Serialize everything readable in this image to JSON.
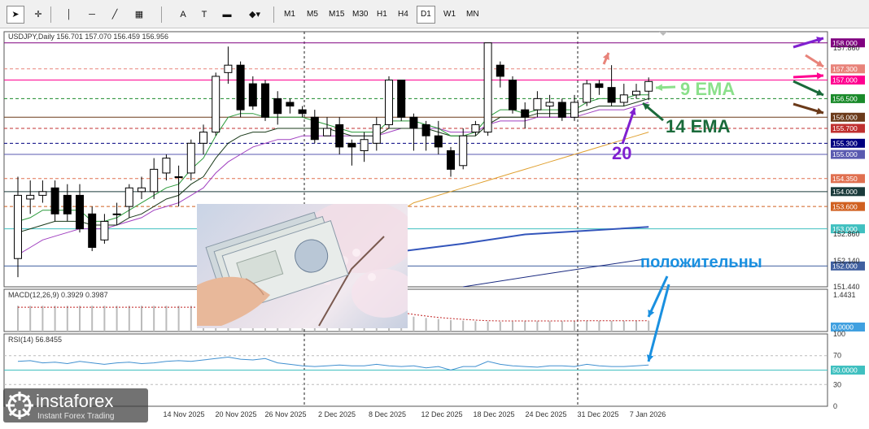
{
  "toolbar": {
    "tools": [
      "cursor-icon",
      "crosshair-icon",
      "vertical-line-icon",
      "horizontal-line-icon",
      "trendline-icon",
      "fibonacci-icon",
      "A",
      "text-label-icon",
      "rectangle-icon",
      "shapes-dropdown-icon"
    ],
    "timeframes": [
      "M1",
      "M5",
      "M15",
      "M30",
      "H1",
      "H4",
      "D1",
      "W1",
      "MN"
    ],
    "selected_timeframe": "D1"
  },
  "chart_data": {
    "type": "candlestick",
    "symbol_header": "USDJPY,Daily  156.701 157.070 156.459 156.956",
    "ylim": [
      151.44,
      158.3
    ],
    "y_ticks": [
      157.86,
      152.86,
      152.14,
      151.44
    ],
    "x_tick_labels": [
      "14 Nov 2025",
      "20 Nov 2025",
      "26 Nov 2025",
      "2 Dec 2025",
      "8 Dec 2025",
      "12 Dec 2025",
      "18 Dec 2025",
      "24 Dec 2025",
      "31 Dec 2025",
      "7 Jan 2026"
    ],
    "price_levels": [
      {
        "label": "158.000",
        "value": 158.0,
        "color": "#800080",
        "style": "solid"
      },
      {
        "label": "157.300",
        "value": 157.3,
        "color": "#e8837a",
        "style": "dashed"
      },
      {
        "label": "157.000",
        "value": 157.0,
        "color": "#ff0090",
        "style": "solid"
      },
      {
        "label": "156.500",
        "value": 156.5,
        "color": "#1a8a2a",
        "style": "dashed"
      },
      {
        "label": "156.000",
        "value": 156.0,
        "color": "#6b3a1a",
        "style": "solid"
      },
      {
        "label": "155.700",
        "value": 155.7,
        "color": "#c03030",
        "style": "dashed"
      },
      {
        "label": "155.300",
        "value": 155.3,
        "color": "#000080",
        "style": "dashed"
      },
      {
        "label": "155.000",
        "value": 155.0,
        "color": "#5a5ab0",
        "style": "solid"
      },
      {
        "label": "154.350",
        "value": 154.35,
        "color": "#e07050",
        "style": "dashed"
      },
      {
        "label": "154.000",
        "value": 154.0,
        "color": "#1a3a3a",
        "style": "solid"
      },
      {
        "label": "153.600",
        "value": 153.6,
        "color": "#d06020",
        "style": "dashed"
      },
      {
        "label": "153.000",
        "value": 153.0,
        "color": "#40c0c0",
        "style": "solid"
      },
      {
        "label": "152.000",
        "value": 152.0,
        "color": "#4060a0",
        "style": "solid"
      }
    ],
    "candles": [
      {
        "o": 152.2,
        "c": 153.9,
        "h": 154.4,
        "l": 151.7
      },
      {
        "o": 153.8,
        "c": 153.9,
        "h": 154.3,
        "l": 153.4
      },
      {
        "o": 153.9,
        "c": 154.0,
        "h": 154.3,
        "l": 153.7
      },
      {
        "o": 154.1,
        "c": 153.4,
        "h": 154.3,
        "l": 153.2
      },
      {
        "o": 153.9,
        "c": 153.4,
        "h": 154.2,
        "l": 153.2
      },
      {
        "o": 153.9,
        "c": 153.0,
        "h": 154.2,
        "l": 152.9
      },
      {
        "o": 153.4,
        "c": 152.5,
        "h": 153.6,
        "l": 152.4
      },
      {
        "o": 152.7,
        "c": 153.2,
        "h": 153.4,
        "l": 152.6
      },
      {
        "o": 153.4,
        "c": 153.4,
        "h": 153.7,
        "l": 153.1
      },
      {
        "o": 153.6,
        "c": 154.1,
        "h": 154.2,
        "l": 153.3
      },
      {
        "o": 154.0,
        "c": 154.1,
        "h": 154.4,
        "l": 153.8
      },
      {
        "o": 154.0,
        "c": 154.6,
        "h": 154.9,
        "l": 153.8
      },
      {
        "o": 154.5,
        "c": 154.9,
        "h": 155.0,
        "l": 154.3
      },
      {
        "o": 154.4,
        "c": 154.4,
        "h": 154.7,
        "l": 153.6
      },
      {
        "o": 154.5,
        "c": 155.3,
        "h": 155.4,
        "l": 154.3
      },
      {
        "o": 155.3,
        "c": 155.6,
        "h": 155.8,
        "l": 155.0
      },
      {
        "o": 155.6,
        "c": 157.1,
        "h": 157.2,
        "l": 155.5
      },
      {
        "o": 157.2,
        "c": 157.4,
        "h": 157.9,
        "l": 156.9
      },
      {
        "o": 157.4,
        "c": 156.2,
        "h": 157.5,
        "l": 156.0
      },
      {
        "o": 156.9,
        "c": 156.3,
        "h": 157.1,
        "l": 156.2
      },
      {
        "o": 156.9,
        "c": 156.0,
        "h": 157.0,
        "l": 155.9
      },
      {
        "o": 156.5,
        "c": 156.1,
        "h": 156.7,
        "l": 155.8
      },
      {
        "o": 156.4,
        "c": 156.3,
        "h": 156.5,
        "l": 156.1
      },
      {
        "o": 156.2,
        "c": 156.1,
        "h": 156.3,
        "l": 156.0
      },
      {
        "o": 156.0,
        "c": 155.4,
        "h": 156.2,
        "l": 155.3
      },
      {
        "o": 155.5,
        "c": 155.7,
        "h": 156.0,
        "l": 155.5
      },
      {
        "o": 155.8,
        "c": 155.2,
        "h": 156.0,
        "l": 155.0
      },
      {
        "o": 155.3,
        "c": 155.2,
        "h": 155.4,
        "l": 154.7
      },
      {
        "o": 155.1,
        "c": 155.4,
        "h": 155.6,
        "l": 154.8
      },
      {
        "o": 155.3,
        "c": 155.8,
        "h": 156.0,
        "l": 155.1
      },
      {
        "o": 155.8,
        "c": 157.0,
        "h": 157.1,
        "l": 155.7
      },
      {
        "o": 157.0,
        "c": 156.0,
        "h": 157.0,
        "l": 155.9
      },
      {
        "o": 156.0,
        "c": 155.7,
        "h": 156.1,
        "l": 155.1
      },
      {
        "o": 155.8,
        "c": 155.5,
        "h": 155.9,
        "l": 155.1
      },
      {
        "o": 155.5,
        "c": 155.2,
        "h": 155.9,
        "l": 155.0
      },
      {
        "o": 155.1,
        "c": 154.6,
        "h": 155.2,
        "l": 154.4
      },
      {
        "o": 154.7,
        "c": 155.5,
        "h": 155.7,
        "l": 154.6
      },
      {
        "o": 155.6,
        "c": 155.8,
        "h": 155.9,
        "l": 155.5
      },
      {
        "o": 155.6,
        "c": 158.0,
        "h": 158.0,
        "l": 155.5
      },
      {
        "o": 157.4,
        "c": 157.1,
        "h": 157.5,
        "l": 156.8
      },
      {
        "o": 157.0,
        "c": 156.2,
        "h": 157.1,
        "l": 156.1
      },
      {
        "o": 156.2,
        "c": 156.0,
        "h": 156.4,
        "l": 155.7
      },
      {
        "o": 156.2,
        "c": 156.5,
        "h": 156.7,
        "l": 156.0
      },
      {
        "o": 156.3,
        "c": 156.4,
        "h": 156.6,
        "l": 156.0
      },
      {
        "o": 156.4,
        "c": 156.0,
        "h": 156.5,
        "l": 155.9
      },
      {
        "o": 156.0,
        "c": 156.4,
        "h": 156.6,
        "l": 155.9
      },
      {
        "o": 156.4,
        "c": 156.9,
        "h": 157.0,
        "l": 156.3
      },
      {
        "o": 156.9,
        "c": 156.8,
        "h": 157.0,
        "l": 156.6
      },
      {
        "o": 156.8,
        "c": 156.4,
        "h": 157.4,
        "l": 156.3
      },
      {
        "o": 156.4,
        "c": 156.6,
        "h": 156.9,
        "l": 156.3
      },
      {
        "o": 156.6,
        "c": 156.7,
        "h": 156.9,
        "l": 156.5
      },
      {
        "o": 156.7,
        "c": 156.96,
        "h": 157.07,
        "l": 156.46
      }
    ],
    "ema9": [
      153.2,
      153.3,
      153.5,
      153.5,
      153.5,
      153.5,
      153.2,
      153.2,
      153.3,
      153.5,
      153.7,
      153.9,
      154.1,
      154.2,
      154.6,
      154.9,
      155.5,
      156.0,
      156.1,
      156.1,
      156.0,
      156.0,
      156.0,
      156.0,
      155.9,
      155.8,
      155.7,
      155.6,
      155.6,
      155.6,
      155.9,
      155.9,
      155.9,
      155.8,
      155.7,
      155.5,
      155.5,
      155.6,
      156.0,
      156.2,
      156.2,
      156.1,
      156.2,
      156.2,
      156.2,
      156.2,
      156.4,
      156.5,
      156.5,
      156.5,
      156.6,
      156.6
    ],
    "ema14": [
      152.9,
      153.0,
      153.1,
      153.2,
      153.2,
      153.2,
      153.1,
      153.1,
      153.1,
      153.3,
      153.4,
      153.6,
      153.8,
      153.9,
      154.2,
      154.4,
      154.9,
      155.3,
      155.5,
      155.6,
      155.6,
      155.7,
      155.7,
      155.7,
      155.7,
      155.7,
      155.6,
      155.5,
      155.5,
      155.5,
      155.7,
      155.7,
      155.7,
      155.7,
      155.6,
      155.5,
      155.5,
      155.5,
      155.8,
      156.0,
      156.0,
      156.0,
      156.1,
      156.1,
      156.1,
      156.1,
      156.2,
      156.3,
      156.3,
      156.3,
      156.4,
      156.5
    ],
    "ema20": [
      152.3,
      152.5,
      152.7,
      152.8,
      152.9,
      153.0,
      153.0,
      153.0,
      153.1,
      153.2,
      153.3,
      153.5,
      153.6,
      153.7,
      153.9,
      154.1,
      154.5,
      154.8,
      155.0,
      155.2,
      155.3,
      155.4,
      155.4,
      155.5,
      155.5,
      155.5,
      155.5,
      155.5,
      155.5,
      155.5,
      155.6,
      155.7,
      155.7,
      155.7,
      155.7,
      155.6,
      155.6,
      155.6,
      155.8,
      155.9,
      155.9,
      155.9,
      156.0,
      156.0,
      156.0,
      156.0,
      156.1,
      156.2,
      156.2,
      156.2,
      156.3,
      156.4
    ],
    "ma_orange_from_index": 30,
    "ma_orange": [
      153.3,
      153.5,
      153.7,
      153.8,
      153.9,
      154.0,
      154.1,
      154.2,
      154.3,
      154.4,
      154.5,
      154.6,
      154.7,
      154.8,
      154.9,
      155.0,
      155.1,
      155.2,
      155.3,
      155.4,
      155.5,
      155.6
    ],
    "blue_lines": [
      {
        "color": "#3355bb",
        "points": [
          [
            152.35,
            30
          ],
          [
            152.6,
            36
          ],
          [
            152.85,
            41
          ],
          [
            153.05,
            51
          ]
        ]
      },
      {
        "color": "#1a2a80",
        "points": [
          [
            151.44,
            36
          ],
          [
            151.8,
            43
          ],
          [
            152.2,
            51
          ]
        ]
      }
    ],
    "macd": {
      "label": "MACD(12,26,9) 0.3929 0.3987",
      "axis_top": "1.4431",
      "axis_bottom": "0.0000",
      "hist": [
        0.95,
        0.95,
        0.95,
        0.95,
        0.95,
        0.95,
        0.95,
        0.95,
        0.95,
        0.95,
        0.95,
        0.95,
        0.95,
        0.95,
        0.95,
        0.95,
        0.95,
        0.95,
        0.95,
        0.95,
        0.95,
        0.95,
        0.95,
        0.95,
        0.95,
        0.95,
        0.95,
        0.95,
        0.95,
        0.95,
        0.7,
        0.62,
        0.55,
        0.5,
        0.46,
        0.42,
        0.4,
        0.38,
        0.37,
        0.36,
        0.37,
        0.38,
        0.38,
        0.38,
        0.38,
        0.38,
        0.39,
        0.39,
        0.39,
        0.39,
        0.39,
        0.39
      ],
      "signal": [
        0.9,
        0.9,
        0.9,
        0.9,
        0.9,
        0.9,
        0.9,
        0.9,
        0.9,
        0.9,
        0.9,
        0.9,
        0.9,
        0.9,
        0.9,
        0.9,
        0.9,
        0.9,
        0.9,
        0.9,
        0.9,
        0.9,
        0.9,
        0.9,
        0.9,
        0.9,
        0.9,
        0.9,
        0.9,
        0.9,
        0.78,
        0.7,
        0.63,
        0.57,
        0.52,
        0.48,
        0.45,
        0.42,
        0.4,
        0.39,
        0.39,
        0.39,
        0.39,
        0.39,
        0.39,
        0.39,
        0.4,
        0.4,
        0.4,
        0.4,
        0.4,
        0.4
      ]
    },
    "rsi": {
      "label": "RSI(14) 56.8455",
      "ticks": [
        "100",
        "70",
        "50",
        "30",
        "0"
      ],
      "current": "50.0000",
      "values": [
        62,
        63,
        60,
        61,
        59,
        62,
        60,
        58,
        60,
        61,
        59,
        60,
        62,
        63,
        62,
        64,
        66,
        68,
        65,
        64,
        66,
        60,
        58,
        56,
        55,
        56,
        57,
        56,
        56,
        58,
        56,
        55,
        56,
        53,
        55,
        50,
        55,
        55,
        62,
        58,
        56,
        55,
        54,
        56,
        56,
        55,
        58,
        56,
        55,
        55,
        56,
        57
      ]
    },
    "annotations": [
      {
        "text": "9 EMA",
        "color": "#8be08b"
      },
      {
        "text": "14 EMA",
        "color": "#1a6a3a"
      },
      {
        "text": "20",
        "color": "#8020d0"
      },
      {
        "text": "положительны",
        "color": "#1a90e0"
      }
    ]
  },
  "logo": {
    "brand": "instaforex",
    "tagline": "Instant Forex Trading"
  }
}
